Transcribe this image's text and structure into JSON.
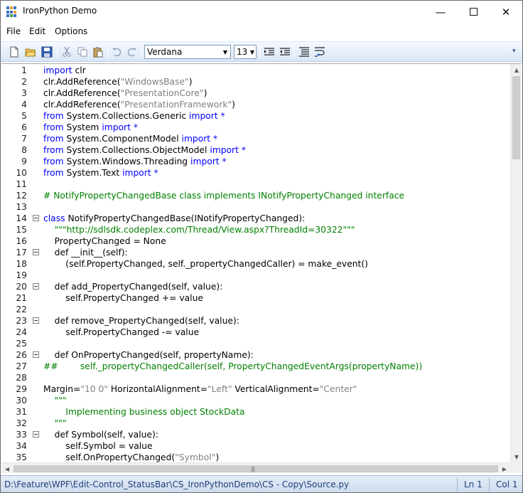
{
  "window": {
    "title": "IronPython Demo",
    "minimize": "—",
    "close": "✕"
  },
  "menu": [
    "File",
    "Edit",
    "Options"
  ],
  "toolbar": {
    "font": "Verdana",
    "size": "13"
  },
  "code_lines": [
    {
      "n": "1",
      "tokens": [
        {
          "t": "import",
          "c": "kw"
        },
        {
          "t": " clr",
          "c": "pl"
        }
      ]
    },
    {
      "n": "2",
      "tokens": [
        {
          "t": "clr.AddReference(",
          "c": "pl"
        },
        {
          "t": "\"WindowsBase\"",
          "c": "str"
        },
        {
          "t": ")",
          "c": "pl"
        }
      ]
    },
    {
      "n": "3",
      "tokens": [
        {
          "t": "clr.AddReference(",
          "c": "pl"
        },
        {
          "t": "\"PresentationCore\"",
          "c": "str"
        },
        {
          "t": ")",
          "c": "pl"
        }
      ]
    },
    {
      "n": "4",
      "tokens": [
        {
          "t": "clr.AddReference(",
          "c": "pl"
        },
        {
          "t": "\"PresentationFramework\"",
          "c": "str"
        },
        {
          "t": ")",
          "c": "pl"
        }
      ]
    },
    {
      "n": "5",
      "tokens": [
        {
          "t": "from",
          "c": "kw"
        },
        {
          "t": " System.Collections.Generic ",
          "c": "pl"
        },
        {
          "t": "import *",
          "c": "kw"
        }
      ]
    },
    {
      "n": "6",
      "tokens": [
        {
          "t": "from",
          "c": "kw"
        },
        {
          "t": " System ",
          "c": "pl"
        },
        {
          "t": "import *",
          "c": "kw"
        }
      ]
    },
    {
      "n": "7",
      "tokens": [
        {
          "t": "from",
          "c": "kw"
        },
        {
          "t": " System.ComponentModel ",
          "c": "pl"
        },
        {
          "t": "import *",
          "c": "kw"
        }
      ]
    },
    {
      "n": "8",
      "tokens": [
        {
          "t": "from",
          "c": "kw"
        },
        {
          "t": " System.Collections.ObjectModel ",
          "c": "pl"
        },
        {
          "t": "import *",
          "c": "kw"
        }
      ]
    },
    {
      "n": "9",
      "tokens": [
        {
          "t": "from",
          "c": "kw"
        },
        {
          "t": " System.Windows.Threading ",
          "c": "pl"
        },
        {
          "t": "import *",
          "c": "kw"
        }
      ]
    },
    {
      "n": "10",
      "tokens": [
        {
          "t": "from",
          "c": "kw"
        },
        {
          "t": " System.Text ",
          "c": "pl"
        },
        {
          "t": "import *",
          "c": "kw"
        }
      ]
    },
    {
      "n": "11",
      "tokens": []
    },
    {
      "n": "12",
      "tokens": [
        {
          "t": "# NotifyPropertyChangedBase class implements INotifyPropertyChanged interface",
          "c": "cmt"
        }
      ]
    },
    {
      "n": "13",
      "tokens": []
    },
    {
      "n": "14",
      "fold": true,
      "tokens": [
        {
          "t": "class",
          "c": "kw"
        },
        {
          "t": " NotifyPropertyChangedBase(INotifyPropertyChanged):",
          "c": "pl"
        }
      ]
    },
    {
      "n": "15",
      "tokens": [
        {
          "t": "    \"\"\"http://sdlsdk.codeplex.com/Thread/View.aspx?ThreadId=30322\"\"\"",
          "c": "cmt"
        }
      ]
    },
    {
      "n": "16",
      "tokens": [
        {
          "t": "    PropertyChanged = None",
          "c": "pl"
        }
      ]
    },
    {
      "n": "17",
      "fold": true,
      "tokens": [
        {
          "t": "    def __init__(self):",
          "c": "pl"
        }
      ]
    },
    {
      "n": "18",
      "tokens": [
        {
          "t": "        (self.PropertyChanged, self._propertyChangedCaller) = make_event()",
          "c": "pl"
        }
      ]
    },
    {
      "n": "19",
      "tokens": []
    },
    {
      "n": "20",
      "fold": true,
      "tokens": [
        {
          "t": "    def add_PropertyChanged(self, value):",
          "c": "pl"
        }
      ]
    },
    {
      "n": "21",
      "tokens": [
        {
          "t": "        self.PropertyChanged += value",
          "c": "pl"
        }
      ]
    },
    {
      "n": "22",
      "tokens": []
    },
    {
      "n": "23",
      "fold": true,
      "tokens": [
        {
          "t": "    def remove_PropertyChanged(self, value):",
          "c": "pl"
        }
      ]
    },
    {
      "n": "24",
      "tokens": [
        {
          "t": "        self.PropertyChanged -= value",
          "c": "pl"
        }
      ]
    },
    {
      "n": "25",
      "tokens": []
    },
    {
      "n": "26",
      "fold": true,
      "tokens": [
        {
          "t": "    def OnPropertyChanged(self, propertyName):",
          "c": "pl"
        }
      ]
    },
    {
      "n": "27",
      "tokens": [
        {
          "t": "##        self._propertyChangedCaller(self, PropertyChangedEventArgs(propertyName))",
          "c": "cmt"
        }
      ]
    },
    {
      "n": "28",
      "tokens": []
    },
    {
      "n": "29",
      "tokens": [
        {
          "t": "Margin=",
          "c": "pl"
        },
        {
          "t": "\"10 0\"",
          "c": "str"
        },
        {
          "t": " HorizontalAlignment=",
          "c": "pl"
        },
        {
          "t": "\"Left\"",
          "c": "str"
        },
        {
          "t": " VerticalAlignment=",
          "c": "pl"
        },
        {
          "t": "\"Center\"",
          "c": "str"
        }
      ]
    },
    {
      "n": "30",
      "tokens": [
        {
          "t": "    \"\"\"",
          "c": "cmt"
        }
      ]
    },
    {
      "n": "31",
      "tokens": [
        {
          "t": "        Implementing business object StockData",
          "c": "cmt"
        }
      ]
    },
    {
      "n": "32",
      "tokens": [
        {
          "t": "    \"\"\"",
          "c": "cmt"
        }
      ]
    },
    {
      "n": "33",
      "fold": true,
      "tokens": [
        {
          "t": "    def Symbol(self, value):",
          "c": "pl"
        }
      ]
    },
    {
      "n": "34",
      "tokens": [
        {
          "t": "        self.Symbol = value",
          "c": "pl"
        }
      ]
    },
    {
      "n": "35",
      "tokens": [
        {
          "t": "        self.OnPropertyChanged(",
          "c": "pl"
        },
        {
          "t": "\"Symbol\"",
          "c": "str"
        },
        {
          "t": ")",
          "c": "pl"
        }
      ]
    }
  ],
  "status": {
    "path": "D:\\Feature\\WPF\\Edit-Control_StatusBar\\CS_IronPythonDemo\\CS - Copy\\Source.py",
    "line": "Ln 1",
    "col": "Col 1"
  }
}
